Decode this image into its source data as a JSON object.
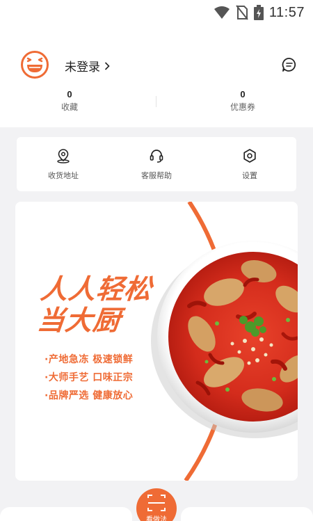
{
  "status_bar": {
    "time": "11:57"
  },
  "profile": {
    "login_label": "未登录"
  },
  "stats": [
    {
      "count": "0",
      "label": "收藏"
    },
    {
      "count": "0",
      "label": "优惠券"
    }
  ],
  "menu": [
    {
      "label": "收货地址",
      "icon": "location-pin-icon"
    },
    {
      "label": "客服帮助",
      "icon": "headset-icon"
    },
    {
      "label": "设置",
      "icon": "gear-icon"
    }
  ],
  "banner": {
    "title_line1": "人人轻松",
    "title_line2": "当大厨",
    "slogans": [
      "·产地急冻 极速锁鲜",
      "·大师手艺 口味正宗",
      "·品牌严选 健康放心"
    ]
  },
  "bottom_nav": {
    "scan_label": "看做法"
  },
  "colors": {
    "accent": "#ef6b35",
    "background": "#f2f2f4",
    "card": "#ffffff"
  }
}
